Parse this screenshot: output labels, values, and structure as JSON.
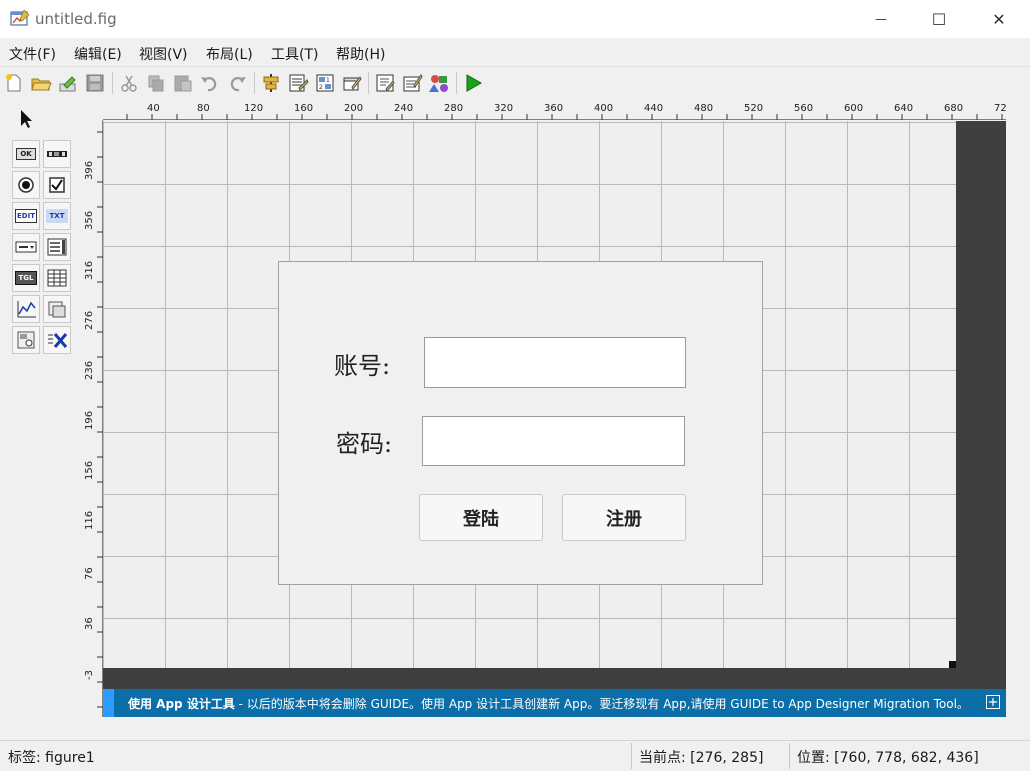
{
  "window": {
    "title": "untitled.fig",
    "minimize_glyph": "—",
    "maximize_glyph": "☐",
    "close_glyph": "✕"
  },
  "menu": [
    "文件(F)",
    "编辑(E)",
    "视图(V)",
    "布局(L)",
    "工具(T)",
    "帮助(H)"
  ],
  "toolbar_icons": [
    "new-file-icon",
    "open-folder-icon",
    "export-icon",
    "save-icon",
    "cut-icon",
    "copy-icon",
    "paste-icon",
    "undo-icon",
    "redo-icon",
    "align-objects-icon",
    "menu-editor-icon",
    "tab-order-editor-icon",
    "toolbar-editor-icon",
    "editor-icon",
    "property-inspector-icon",
    "object-browser-icon",
    "run-icon"
  ],
  "palette": {
    "select_tool": "select-arrow-icon",
    "components": [
      {
        "icon": "push-button-icon",
        "text": "OK"
      },
      {
        "icon": "slider-icon",
        "text": ""
      },
      {
        "icon": "radio-button-icon",
        "text": ""
      },
      {
        "icon": "checkbox-icon",
        "text": ""
      },
      {
        "icon": "edit-text-icon",
        "text": "EDIT"
      },
      {
        "icon": "static-text-icon",
        "text": "TXT"
      },
      {
        "icon": "popup-menu-icon",
        "text": ""
      },
      {
        "icon": "listbox-icon",
        "text": ""
      },
      {
        "icon": "toggle-button-icon",
        "text": "TGL"
      },
      {
        "icon": "table-icon",
        "text": ""
      },
      {
        "icon": "axes-icon",
        "text": ""
      },
      {
        "icon": "panel-icon",
        "text": ""
      },
      {
        "icon": "button-group-icon",
        "text": ""
      },
      {
        "icon": "activex-control-icon",
        "text": ""
      }
    ]
  },
  "ruler": {
    "x_ticks": [
      "40",
      "80",
      "120",
      "160",
      "200",
      "240",
      "280",
      "320",
      "360",
      "400",
      "440",
      "480",
      "520",
      "560",
      "600",
      "640",
      "680",
      "72"
    ],
    "y_ticks": [
      "396",
      "356",
      "316",
      "276",
      "236",
      "196",
      "156",
      "116",
      "76",
      "36",
      "-3"
    ]
  },
  "form": {
    "account_label": "账号:",
    "password_label": "密码:",
    "account_value": "",
    "password_value": "",
    "login_button": "登陆",
    "register_button": "注册"
  },
  "banner": {
    "bold_text": "使用 App 设计工具",
    "text": " - 以后的版本中将会删除 GUIDE。使用 App 设计工具创建新 App。要迁移现有 App,请使用 GUIDE to App Designer Migration Tool。",
    "expand_icon": "expand-icon"
  },
  "status": {
    "tag": "标签: figure1",
    "current_point": "当前点:  [276, 285]",
    "position": "位置: [760, 778, 682, 436]"
  },
  "colors": {
    "banner_bg": "#0b6ea8",
    "banner_accent": "#2e9cff",
    "canvas_dark": "#3f3f3f",
    "run_green": "#1aa31a"
  }
}
